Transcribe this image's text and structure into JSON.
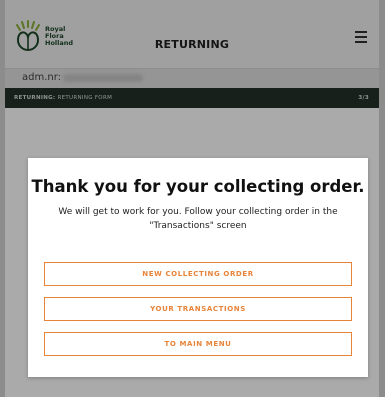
{
  "header": {
    "brand_lines": [
      "Royal",
      "Flora",
      "Holland"
    ],
    "title": "RETURNING",
    "menu_icon": "hamburger-menu-icon"
  },
  "admin": {
    "label": "adm.nr:"
  },
  "breadcrumb": {
    "section": "RETURNING:",
    "page": "RETURNING FORM",
    "step": "3/3"
  },
  "modal": {
    "title": "Thank you for your collecting order.",
    "body": "We will get to work for you. Follow your collecting order in the \"Transactions\" screen",
    "buttons": {
      "new_order": "NEW COLLECTING ORDER",
      "transactions": "YOUR TRANSACTIONS",
      "main_menu": "TO MAIN MENU"
    }
  },
  "colors": {
    "accent": "#e8843a",
    "breadcrumb_bg": "#24332a",
    "brand_green": "#1e4a2c"
  }
}
